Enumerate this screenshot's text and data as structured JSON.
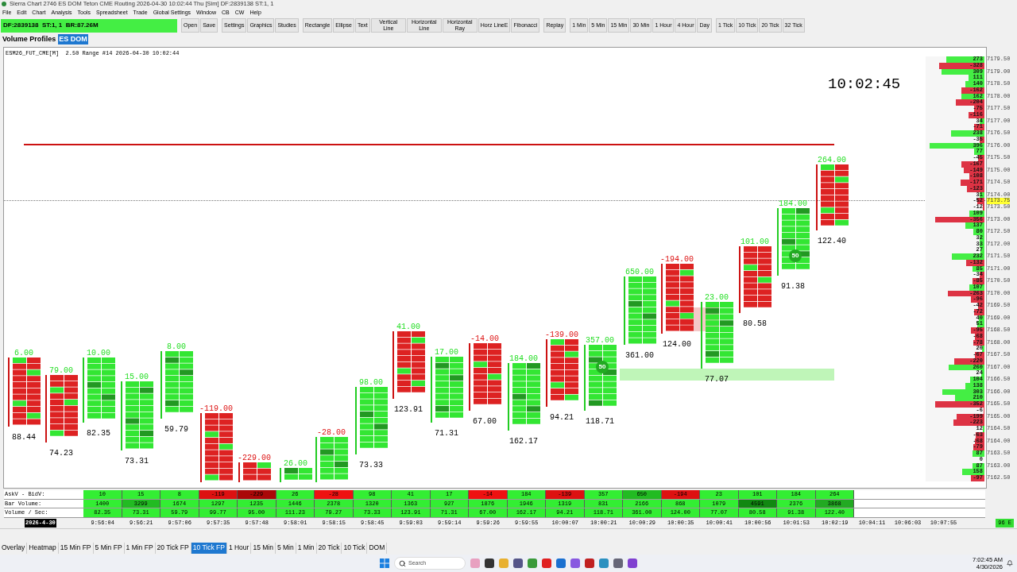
{
  "window": {
    "title": "Sierra Chart 2746 ES DOM Teton CME Routing 2026-04-30 10:02:44 Thu [Sim] DF:2839138 ST:1, 1"
  },
  "menu": [
    "File",
    "Edit",
    "Chart",
    "Analysis",
    "Tools",
    "Spreadsheet",
    "Trade",
    "Global Settings",
    "Window",
    "CB",
    "CW",
    "Help"
  ],
  "status_field": "DF:2839138  ST:1, 1  BR:87.26M",
  "toolbar_groups": [
    [
      "Open",
      "Save"
    ],
    [
      "Settings",
      "Graphics",
      "Studies"
    ],
    [
      "Rectangle",
      "Ellipse",
      "Text",
      "Vertical Line",
      "Horizontal Line",
      "Horizontal Ray",
      "Horz LineE",
      "Fibonacci"
    ],
    [
      "Replay"
    ],
    [
      "1 Min",
      "5 Min",
      "15 Min",
      "30 Min",
      "1 Hour",
      "4 Hour",
      "Day"
    ],
    [
      "1 Tick",
      "10 Tick",
      "20 Tick",
      "32 Tick"
    ]
  ],
  "window_tabs": [
    {
      "label": "Volume Profiles",
      "selected": false
    },
    {
      "label": "ES DOM",
      "selected": true
    }
  ],
  "chart": {
    "header": "ESM26_FUT_CME[M]  2.50 Range #14 2026-04-30 10:02:44",
    "clock": "10:02:45",
    "markers": [
      "50",
      "50"
    ],
    "bars": [
      {
        "delta": "6.00",
        "negative": false,
        "rate": "88.44",
        "kind": "down"
      },
      {
        "delta": "79.00",
        "negative": false,
        "rate": "74.23",
        "kind": "down"
      },
      {
        "delta": "10.00",
        "negative": false,
        "rate": "82.35",
        "kind": "up"
      },
      {
        "delta": "15.00",
        "negative": false,
        "rate": "73.31",
        "kind": "up"
      },
      {
        "delta": "8.00",
        "negative": false,
        "rate": "59.79",
        "kind": "up"
      },
      {
        "delta": "-119.00",
        "negative": true,
        "kind": "down"
      },
      {
        "delta": "-229.00",
        "negative": true,
        "kind": "down"
      },
      {
        "delta": "26.00",
        "negative": false,
        "kind": "up"
      },
      {
        "delta": "-28.00",
        "negative": true,
        "kind": "up"
      },
      {
        "delta": "98.00",
        "negative": false,
        "rate": "73.33",
        "kind": "up"
      },
      {
        "delta": "41.00",
        "negative": false,
        "rate": "123.91",
        "kind": "down"
      },
      {
        "delta": "17.00",
        "negative": false,
        "rate": "71.31",
        "kind": "up"
      },
      {
        "delta": "-14.00",
        "negative": true,
        "rate": "67.00",
        "kind": "down"
      },
      {
        "delta": "184.00",
        "negative": false,
        "rate": "162.17",
        "kind": "up"
      },
      {
        "delta": "-139.00",
        "negative": true,
        "rate": "94.21",
        "kind": "down"
      },
      {
        "delta": "357.00",
        "negative": false,
        "rate": "118.71",
        "kind": "up"
      },
      {
        "delta": "650.00",
        "negative": false,
        "rate": "361.00",
        "kind": "up"
      },
      {
        "delta": "-194.00",
        "negative": true,
        "rate": "124.00",
        "kind": "down"
      },
      {
        "delta": "23.00",
        "negative": false,
        "rate": "77.07",
        "kind": "up"
      },
      {
        "delta": "101.00",
        "negative": false,
        "rate": "80.58",
        "kind": "down"
      },
      {
        "delta": "184.00",
        "negative": false,
        "rate": "91.38",
        "kind": "up"
      },
      {
        "delta": "264.00",
        "negative": false,
        "rate": "122.40",
        "kind": "down"
      }
    ],
    "profile": [
      {
        "value": "273",
        "kind": "ask",
        "level": 0.68,
        "price": "7179.50"
      },
      {
        "value": "-328",
        "kind": "bid",
        "level": 0.82
      },
      {
        "value": "309",
        "kind": "ask",
        "level": 0.77,
        "price": "7179.00"
      },
      {
        "value": "111",
        "kind": "ask",
        "level": 0.28
      },
      {
        "value": "140",
        "kind": "ask",
        "level": 0.35,
        "price": "7178.50"
      },
      {
        "value": "-162",
        "kind": "bid",
        "level": 0.41
      },
      {
        "value": "162",
        "kind": "ask",
        "level": 0.41,
        "price": "7178.00"
      },
      {
        "value": "-204",
        "kind": "bid",
        "level": 0.51
      },
      {
        "value": "-75",
        "kind": "bid",
        "level": 0.19,
        "price": "7177.50"
      },
      {
        "value": "-116",
        "kind": "bid",
        "level": 0.29
      },
      {
        "value": "34",
        "kind": "ask",
        "level": 0.09,
        "price": "7177.00"
      },
      {
        "value": "-71",
        "kind": "bid",
        "level": 0.18
      },
      {
        "value": "238",
        "kind": "ask",
        "level": 0.6,
        "price": "7176.50"
      },
      {
        "value": "-35",
        "kind": "bid",
        "level": 0.09
      },
      {
        "value": "396",
        "kind": "ask",
        "level": 0.99,
        "price": "7176.00"
      },
      {
        "value": "77",
        "kind": "ask",
        "level": 0.19
      },
      {
        "value": "-45",
        "kind": "bid",
        "level": 0.11,
        "price": "7175.50"
      },
      {
        "value": "-167",
        "kind": "bid",
        "level": 0.42
      },
      {
        "value": "-149",
        "kind": "bid",
        "level": 0.37,
        "price": "7175.00"
      },
      {
        "value": "-108",
        "kind": "bid",
        "level": 0.27
      },
      {
        "value": "-171",
        "kind": "bid",
        "level": 0.43,
        "price": "7174.50"
      },
      {
        "value": "-123",
        "kind": "bid",
        "level": 0.31
      },
      {
        "value": "31",
        "kind": "ask",
        "level": 0.08,
        "price": "7174.00"
      },
      {
        "value": "-52",
        "kind": "bid",
        "level": 0.13,
        "price": "7173.75",
        "current": true
      },
      {
        "value": "-12",
        "kind": "bid",
        "level": 0.03,
        "price": "7173.50"
      },
      {
        "value": "109",
        "kind": "ask",
        "level": 0.27
      },
      {
        "value": "-356",
        "kind": "bid",
        "level": 0.89,
        "price": "7173.00"
      },
      {
        "value": "137",
        "kind": "ask",
        "level": 0.34
      },
      {
        "value": "80",
        "kind": "ask",
        "level": 0.2,
        "price": "7172.50"
      },
      {
        "value": "32",
        "kind": "ask",
        "level": 0.08
      },
      {
        "value": "33",
        "kind": "ask",
        "level": 0.08,
        "price": "7172.00"
      },
      {
        "value": "27",
        "kind": "ask",
        "level": 0.07
      },
      {
        "value": "232",
        "kind": "ask",
        "level": 0.58,
        "price": "7171.50"
      },
      {
        "value": "-132",
        "kind": "bid",
        "level": 0.33
      },
      {
        "value": "85",
        "kind": "ask",
        "level": 0.21,
        "price": "7171.00"
      },
      {
        "value": "-34",
        "kind": "bid",
        "level": 0.09
      },
      {
        "value": "-85",
        "kind": "bid",
        "level": 0.21,
        "price": "7170.50"
      },
      {
        "value": "107",
        "kind": "ask",
        "level": 0.27
      },
      {
        "value": "-263",
        "kind": "bid",
        "level": 0.66,
        "price": "7170.00"
      },
      {
        "value": "-96",
        "kind": "bid",
        "level": 0.24
      },
      {
        "value": "-42",
        "kind": "bid",
        "level": 0.11,
        "price": "7169.50"
      },
      {
        "value": "-72",
        "kind": "bid",
        "level": 0.18
      },
      {
        "value": "40",
        "kind": "ask",
        "level": 0.1,
        "price": "7169.00"
      },
      {
        "value": "51",
        "kind": "ask",
        "level": 0.13
      },
      {
        "value": "-95",
        "kind": "bid",
        "level": 0.24,
        "price": "7168.50"
      },
      {
        "value": "-68",
        "kind": "bid",
        "level": 0.17
      },
      {
        "value": "-78",
        "kind": "bid",
        "level": 0.2,
        "price": "7168.00"
      },
      {
        "value": "20",
        "kind": "ask",
        "level": 0.05
      },
      {
        "value": "-67",
        "kind": "bid",
        "level": 0.17,
        "price": "7167.50"
      },
      {
        "value": "-220",
        "kind": "bid",
        "level": 0.55
      },
      {
        "value": "260",
        "kind": "ask",
        "level": 0.65,
        "price": "7167.00"
      },
      {
        "value": "24",
        "kind": "ask",
        "level": 0.06
      },
      {
        "value": "104",
        "kind": "ask",
        "level": 0.26,
        "price": "7166.50"
      },
      {
        "value": "138",
        "kind": "ask",
        "level": 0.35
      },
      {
        "value": "303",
        "kind": "ask",
        "level": 0.76,
        "price": "7166.00"
      },
      {
        "value": "210",
        "kind": "ask",
        "level": 0.53
      },
      {
        "value": "-352",
        "kind": "bid",
        "level": 0.88,
        "price": "7165.50"
      },
      {
        "value": "-6",
        "kind": "bid",
        "level": 0.02
      },
      {
        "value": "-199",
        "kind": "bid",
        "level": 0.5,
        "price": "7165.00"
      },
      {
        "value": "-223",
        "kind": "bid",
        "level": 0.56
      },
      {
        "value": "12",
        "kind": "ask",
        "level": 0.03,
        "price": "7164.50"
      },
      {
        "value": "-63",
        "kind": "bid",
        "level": 0.16
      },
      {
        "value": "-68",
        "kind": "bid",
        "level": 0.17,
        "price": "7164.00"
      },
      {
        "value": "-79",
        "kind": "bid",
        "level": 0.2
      },
      {
        "value": "87",
        "kind": "ask",
        "level": 0.22,
        "price": "7163.50"
      },
      {
        "value": "0"
      },
      {
        "value": "87",
        "kind": "ask",
        "level": 0.22,
        "price": "7163.00"
      },
      {
        "value": "158",
        "kind": "ask",
        "level": 0.4
      },
      {
        "value": "-97",
        "kind": "bid",
        "level": 0.24,
        "price": "7162.50"
      }
    ],
    "table": {
      "rows": [
        {
          "label": "AskV - BidV:",
          "cells": [
            {
              "text": "10",
              "color": "#33ee33"
            },
            {
              "text": "15",
              "color": "#33ee33"
            },
            {
              "text": "8",
              "color": "#33ee33"
            },
            {
              "text": "-119",
              "color": "#dd1111"
            },
            {
              "text": "-229",
              "color": "#aa0808"
            },
            {
              "text": "26",
              "color": "#33ee33"
            },
            {
              "text": "-28",
              "color": "#ee1111"
            },
            {
              "text": "98",
              "color": "#33ee33"
            },
            {
              "text": "41",
              "color": "#33ee33"
            },
            {
              "text": "17",
              "color": "#33ee33"
            },
            {
              "text": "-14",
              "color": "#ee1111"
            },
            {
              "text": "184",
              "color": "#33ee33"
            },
            {
              "text": "-139",
              "color": "#dd1111"
            },
            {
              "text": "357",
              "color": "#33ee33"
            },
            {
              "text": "650",
              "color": "#22bb22"
            },
            {
              "text": "-194",
              "color": "#dd1111"
            },
            {
              "text": "23",
              "color": "#33ee33"
            },
            {
              "text": "101",
              "color": "#33ee33"
            },
            {
              "text": "184",
              "color": "#33ee33"
            },
            {
              "text": "264",
              "color": "#33ee33"
            }
          ]
        },
        {
          "label": "Bar Volume:",
          "cells": [
            {
              "text": "1400",
              "color": "#33ee33"
            },
            {
              "text": "3299",
              "color": "#22bb22"
            },
            {
              "text": "1674",
              "color": "#33ee33"
            },
            {
              "text": "1297",
              "color": "#33ee33"
            },
            {
              "text": "1235",
              "color": "#33ee33"
            },
            {
              "text": "1446",
              "color": "#33ee33"
            },
            {
              "text": "2378",
              "color": "#33ee33"
            },
            {
              "text": "1320",
              "color": "#33ee33"
            },
            {
              "text": "1363",
              "color": "#33ee33"
            },
            {
              "text": "927",
              "color": "#33ee33"
            },
            {
              "text": "1876",
              "color": "#33ee33"
            },
            {
              "text": "1946",
              "color": "#33ee33"
            },
            {
              "text": "1319",
              "color": "#33ee33"
            },
            {
              "text": "831",
              "color": "#33ee33"
            },
            {
              "text": "2166",
              "color": "#33ee33"
            },
            {
              "text": "868",
              "color": "#33ee33"
            },
            {
              "text": "1079",
              "color": "#33ee33"
            },
            {
              "text": "4591",
              "color": "#118811"
            },
            {
              "text": "2376",
              "color": "#33ee33"
            },
            {
              "text": "3868",
              "color": "#22aa22"
            }
          ]
        },
        {
          "label": "Volume / Sec:",
          "cells": [
            {
              "text": "82.35",
              "color": "#33ee33"
            },
            {
              "text": "73.31",
              "color": "#33ee33"
            },
            {
              "text": "59.79",
              "color": "#33ee33"
            },
            {
              "text": "99.77",
              "color": "#33ee33"
            },
            {
              "text": "95.00",
              "color": "#33ee33"
            },
            {
              "text": "111.23",
              "color": "#33ee33"
            },
            {
              "text": "79.27",
              "color": "#33ee33"
            },
            {
              "text": "73.33",
              "color": "#33ee33"
            },
            {
              "text": "123.91",
              "color": "#33ee33"
            },
            {
              "text": "71.31",
              "color": "#33ee33"
            },
            {
              "text": "67.00",
              "color": "#33ee33"
            },
            {
              "text": "162.17",
              "color": "#33ee33"
            },
            {
              "text": "94.21",
              "color": "#33ee33"
            },
            {
              "text": "118.71",
              "color": "#33ee33"
            },
            {
              "text": "361.00",
              "color": "#33ee33"
            },
            {
              "text": "124.00",
              "color": "#33ee33"
            },
            {
              "text": "77.07",
              "color": "#33ee33"
            },
            {
              "text": "80.58",
              "color": "#33ee33"
            },
            {
              "text": "91.38",
              "color": "#33ee33"
            },
            {
              "text": "122.40",
              "color": "#33ee33"
            }
          ]
        }
      ]
    },
    "date": "2026-4-30",
    "times": [
      "9:56:04",
      "9:56:21",
      "9:57:06",
      "9:57:35",
      "9:57:48",
      "9:58:01",
      "9:58:15",
      "9:58:45",
      "9:59:03",
      "9:59:14",
      "9:59:26",
      "9:59:55",
      "10:00:07",
      "10:00:21",
      "10:00:29",
      "10:00:35",
      "10:00:41",
      "10:00:56",
      "10:01:53",
      "10:02:19",
      "10:04:11",
      "10:06:03",
      "10:07:55"
    ],
    "corner_badge": "96 E"
  },
  "chart_tabs": [
    {
      "label": "Overlay",
      "selected": false
    },
    {
      "label": "Heatmap",
      "selected": false
    },
    {
      "label": "15 Min FP",
      "selected": false
    },
    {
      "label": "5 Min FP",
      "selected": false
    },
    {
      "label": "1 Min FP",
      "selected": false
    },
    {
      "label": "20 Tick FP",
      "selected": false
    },
    {
      "label": "10 Tick FP",
      "selected": true
    },
    {
      "label": "1 Hour",
      "selected": false
    },
    {
      "label": "15 Min",
      "selected": false
    },
    {
      "label": "5 Min",
      "selected": false
    },
    {
      "label": "1 Min",
      "selected": false
    },
    {
      "label": "20 Tick",
      "selected": false
    },
    {
      "label": "10 Tick",
      "selected": false
    },
    {
      "label": "DOM",
      "selected": false
    }
  ],
  "taskbar": {
    "search_placeholder": "Search",
    "time": "7:02:45 AM",
    "date": "4/30/2026"
  }
}
